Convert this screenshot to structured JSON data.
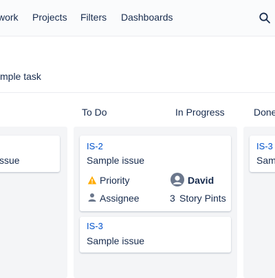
{
  "nav": {
    "items": [
      {
        "label": "work"
      },
      {
        "label": "Projects"
      },
      {
        "label": "Filters"
      },
      {
        "label": "Dashboards"
      }
    ],
    "search_icon": "search-icon"
  },
  "subheader": {
    "text": "mple task"
  },
  "columns": [
    {
      "label": "To Do"
    },
    {
      "label": "In Progress"
    },
    {
      "label": "Done"
    }
  ],
  "left_card": {
    "title": "ssue"
  },
  "cards": [
    {
      "key": "IS-2",
      "title": "Sample issue",
      "priority_label": "Priority",
      "priority_icon": "warning-icon",
      "priority_color": "#ffab00",
      "assignee_label": "Assignee",
      "assignee_icon": "person-icon",
      "assignee_name": "David",
      "story_points": "3",
      "story_points_label": "Story Pints"
    },
    {
      "key": "IS-3",
      "title": "Sample issue"
    }
  ],
  "right_card": {
    "key": "IS-3",
    "title": "Sam"
  },
  "colors": {
    "link": "#0052cc",
    "text": "#172b4d",
    "column_bg": "#f4f5f7"
  }
}
